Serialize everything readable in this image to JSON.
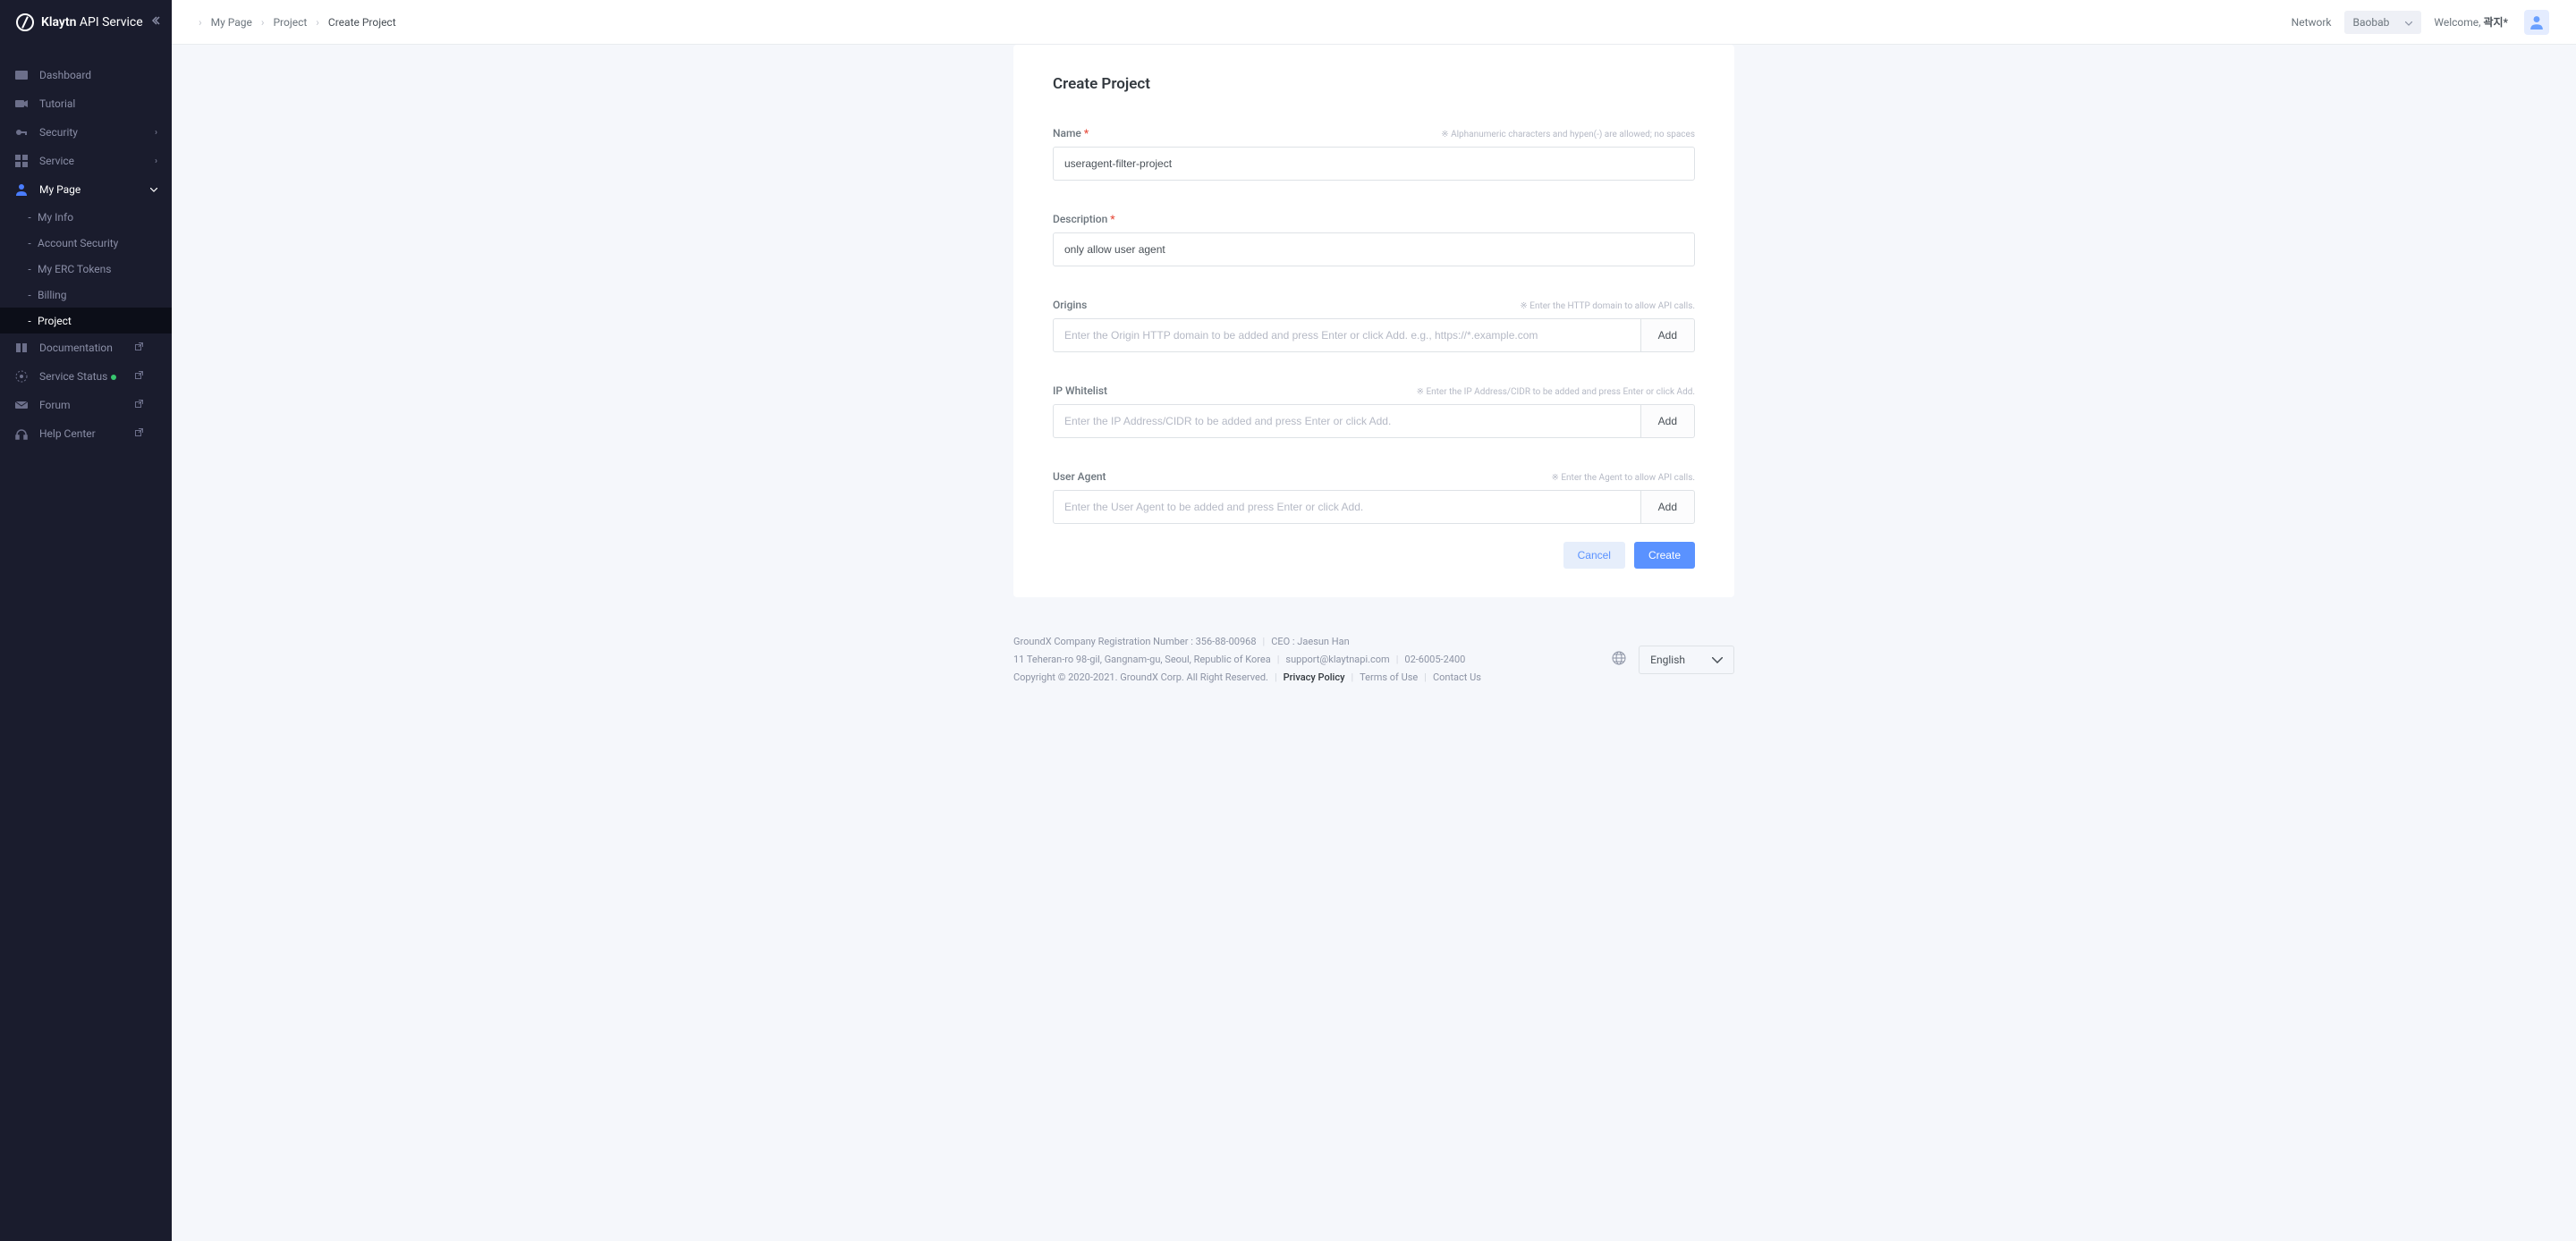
{
  "brand": {
    "name_bold": "Klaytn",
    "name_rest": " API Service"
  },
  "sidebar": {
    "items": [
      {
        "key": "dashboard",
        "label": "Dashboard"
      },
      {
        "key": "tutorial",
        "label": "Tutorial"
      },
      {
        "key": "security",
        "label": "Security",
        "chevron": "right"
      },
      {
        "key": "service",
        "label": "Service",
        "chevron": "right"
      },
      {
        "key": "mypage",
        "label": "My Page",
        "chevron": "down",
        "expanded": true,
        "sub": [
          {
            "key": "myinfo",
            "label": "My Info"
          },
          {
            "key": "accountsecurity",
            "label": "Account Security"
          },
          {
            "key": "erctokens",
            "label": "My ERC Tokens"
          },
          {
            "key": "billing",
            "label": "Billing"
          },
          {
            "key": "project",
            "label": "Project",
            "active": true
          }
        ]
      },
      {
        "key": "documentation",
        "label": "Documentation",
        "external": true
      },
      {
        "key": "servicestatus",
        "label": "Service Status",
        "status_dot": true,
        "external": true
      },
      {
        "key": "forum",
        "label": "Forum",
        "external": true
      },
      {
        "key": "helpcenter",
        "label": "Help Center",
        "external": true
      }
    ]
  },
  "header": {
    "breadcrumbs": [
      "My Page",
      "Project",
      "Create Project"
    ],
    "network_label": "Network",
    "network_value": "Baobab",
    "welcome_prefix": "Welcome, ",
    "welcome_name": "곽지*"
  },
  "form": {
    "title": "Create Project",
    "name_label": "Name",
    "name_hint": "※ Alphanumeric characters and hypen(-) are allowed; no spaces",
    "name_value": "useragent-filter-project",
    "desc_label": "Description",
    "desc_value": "only allow user agent",
    "origins_label": "Origins",
    "origins_hint": "※ Enter the HTTP domain to allow API calls.",
    "origins_placeholder": "Enter the Origin HTTP domain to be added and press Enter or click Add. e.g., https://*.example.com",
    "ip_label": "IP Whitelist",
    "ip_hint": "※ Enter the IP Address/CIDR to be added and press Enter or click Add.",
    "ip_placeholder": "Enter the IP Address/CIDR to be added and press Enter or click Add.",
    "ua_label": "User Agent",
    "ua_hint": "※ Enter the Agent to allow API calls.",
    "ua_placeholder": "Enter the User Agent to be added and press Enter or click Add.",
    "add_btn": "Add",
    "cancel_btn": "Cancel",
    "create_btn": "Create"
  },
  "footer": {
    "reg": "GroundX Company Registration Number : 356-88-00968",
    "ceo": "CEO : Jaesun Han",
    "addr": "11 Teheran-ro 98-gil, Gangnam-gu, Seoul, Republic of Korea",
    "email": "support@klaytnapi.com",
    "phone": "02-6005-2400",
    "copyright": "Copyright © 2020-2021. GroundX Corp. All Right Reserved.",
    "privacy": "Privacy Policy",
    "terms": "Terms of Use",
    "contact": "Contact Us",
    "lang": "English"
  }
}
